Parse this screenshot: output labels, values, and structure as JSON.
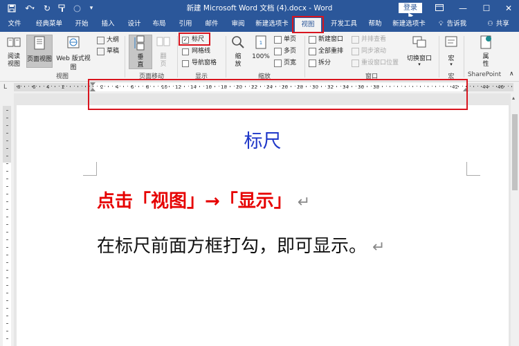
{
  "titlebar": {
    "title": "新建 Microsoft Word 文档 (4).docx  -  Word",
    "login": "登录"
  },
  "tabs": [
    "文件",
    "经典菜单",
    "开始",
    "插入",
    "设计",
    "布局",
    "引用",
    "邮件",
    "审阅",
    "新建选项卡",
    "视图",
    "开发工具",
    "帮助",
    "新建选项卡"
  ],
  "tell_me": "告诉我",
  "share": "共享",
  "ribbon": {
    "views": {
      "read": "阅读视图",
      "print": "页面视图",
      "web": "Web 版式视图",
      "outline": "大纲",
      "draft": "草稿",
      "label": "视图"
    },
    "page_move": {
      "vertical": "垂直",
      "side": "翻页",
      "label": "页面移动"
    },
    "show": {
      "ruler": "标尺",
      "gridlines": "网格线",
      "nav_pane": "导航窗格",
      "label": "显示"
    },
    "zoom": {
      "zoom": "缩放",
      "percent": "100%",
      "one_page": "单页",
      "multi_page": "多页",
      "page_width": "页宽",
      "label": "缩放"
    },
    "window": {
      "new_window": "新建窗口",
      "arrange_all": "全部重排",
      "split": "拆分",
      "side_by_side": "并排查看",
      "sync_scroll": "同步滚动",
      "reset_pos": "重设窗口位置",
      "switch": "切换窗口",
      "label": "窗口"
    },
    "macros": {
      "macro": "宏",
      "label": "宏"
    },
    "sharepoint": {
      "properties": "属性",
      "label": "SharePoint"
    }
  },
  "ruler": {
    "numbers": [
      "8",
      "6",
      "4",
      "2",
      "2",
      "4",
      "6",
      "8",
      "10",
      "12",
      "14",
      "16",
      "18",
      "20",
      "22",
      "24",
      "26",
      "28",
      "30",
      "32",
      "34",
      "36",
      "38",
      "42",
      "44",
      "46"
    ]
  },
  "document": {
    "heading": "标尺",
    "line1": "点击「视图」→「显示」",
    "line2": "在标尺前面方框打勾，即可显示。",
    "para_mark": "↵"
  },
  "colors": {
    "title_bar": "#2b579a",
    "heading": "#1f37c8",
    "emphasis": "#e60000",
    "highlight_box": "#d9141e"
  }
}
